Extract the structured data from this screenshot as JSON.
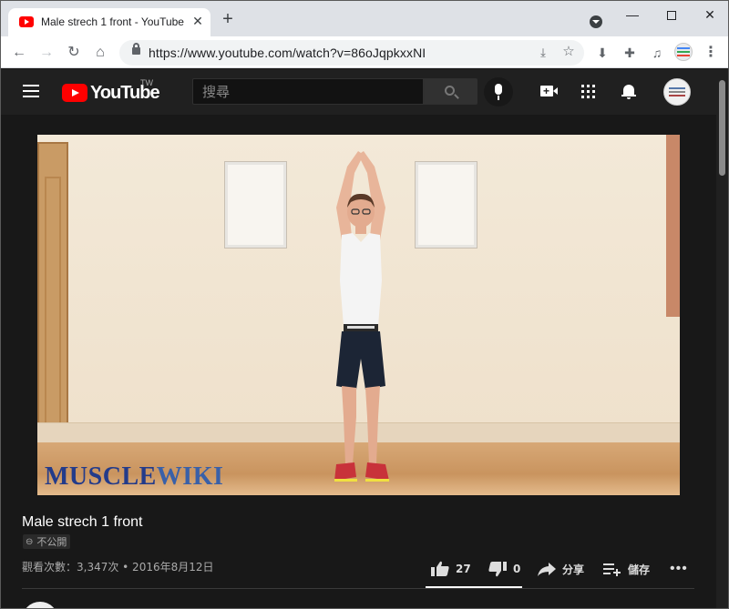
{
  "browser": {
    "tab_title": "Male strech 1 front - YouTube",
    "tab_close": "✕",
    "new_tab": "+",
    "url": "https://www.youtube.com/watch?v=86oJqpkxxNI",
    "icons": [
      "youtube-favicon",
      "back-icon",
      "forward-icon",
      "reload-icon",
      "home-icon",
      "lock-icon",
      "install-icon",
      "star-icon",
      "download-icon",
      "extensions-icon",
      "media-icon",
      "profile-icon",
      "menu-icon"
    ]
  },
  "youtube": {
    "logo_text": "YouTube",
    "country_code": "TW",
    "search_placeholder": "搜尋"
  },
  "video": {
    "watermark_part1": "MUSCLE",
    "watermark_part2": "WIKI",
    "title": "Male strech 1 front",
    "privacy": "不公開",
    "views_and_date": "觀看次數：3,347次 • 2016年8月12日",
    "likes": "27",
    "dislikes": "0",
    "like_fraction": 1.0,
    "share_label": "分享",
    "save_label": "儲存",
    "more": "•••"
  },
  "colors": {
    "youtube_red": "#ff0000",
    "page_background": "#181818",
    "masthead": "#202020",
    "watermark_blue": "#233b8a"
  }
}
